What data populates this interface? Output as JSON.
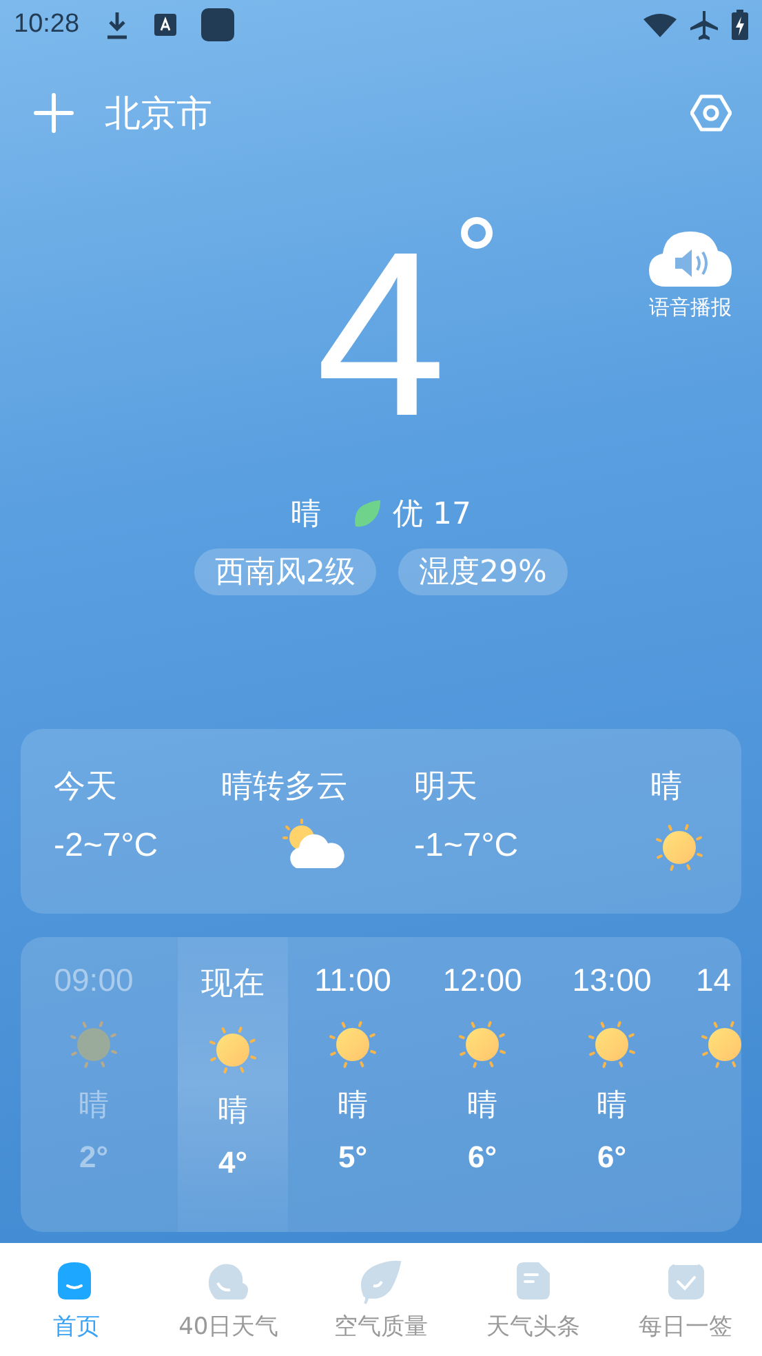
{
  "status_bar": {
    "time": "10:28"
  },
  "header": {
    "city": "北京市"
  },
  "voice": {
    "label": "语音播报"
  },
  "current": {
    "temperature": "4",
    "condition": "晴",
    "air_quality": "优 17",
    "wind": "西南风2级",
    "humidity": "湿度29%"
  },
  "daily": [
    {
      "day": "今天",
      "condition": "晴转多云",
      "range": "-2~7°C",
      "kind": "partly-cloudy"
    },
    {
      "day": "明天",
      "condition": "晴",
      "range": "-1~7°C",
      "kind": "sunny"
    }
  ],
  "hourly": [
    {
      "time": "09:00",
      "kind": "sunny",
      "condition": "晴",
      "temp": "2°",
      "past": true,
      "selected": false
    },
    {
      "time": "现在",
      "kind": "sunny",
      "condition": "晴",
      "temp": "4°",
      "past": false,
      "selected": true
    },
    {
      "time": "11:00",
      "kind": "sunny",
      "condition": "晴",
      "temp": "5°",
      "past": false,
      "selected": false
    },
    {
      "time": "12:00",
      "kind": "sunny",
      "condition": "晴",
      "temp": "6°",
      "past": false,
      "selected": false
    },
    {
      "time": "13:00",
      "kind": "sunny",
      "condition": "晴",
      "temp": "6°",
      "past": false,
      "selected": false
    },
    {
      "time": "14",
      "kind": "sunny",
      "past": false,
      "selected": false
    }
  ],
  "tabs": [
    {
      "label": "首页",
      "selected": true
    },
    {
      "label": "40日天气",
      "selected": false
    },
    {
      "label": "空气质量",
      "selected": false
    },
    {
      "label": "天气头条",
      "selected": false
    },
    {
      "label": "每日一签",
      "selected": false
    }
  ]
}
